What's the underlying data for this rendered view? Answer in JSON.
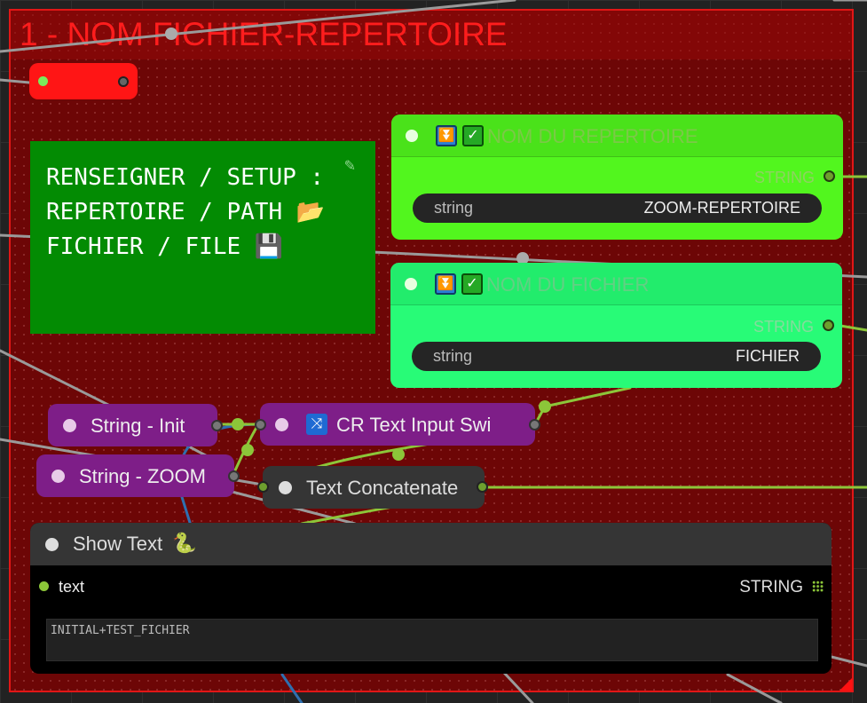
{
  "group": {
    "title": "1 - NOM FICHIER-REPERTOIRE",
    "color": "#e21616"
  },
  "note": {
    "lines": [
      "RENSEIGNER / SETUP :",
      "REPERTOIRE / PATH 📂",
      "FICHIER / FILE 💾"
    ],
    "color": "#038b03"
  },
  "repertoire_node": {
    "title": "NOM DU REPERTOIRE",
    "output_label": "STRING",
    "widget_label": "string",
    "widget_value": "ZOOM-REPERTOIRE",
    "color": "#52f61e"
  },
  "fichier_node": {
    "title": "NOM DU FICHIER",
    "output_label": "STRING",
    "widget_label": "string",
    "widget_value": "FICHIER",
    "color": "#28fb77"
  },
  "string_init": {
    "label": "String - Init",
    "color": "#7e1e88"
  },
  "string_zoom": {
    "label": "String - ZOOM",
    "color": "#7e1e88"
  },
  "cr_switch": {
    "label": "CR Text Input Swi",
    "icon": "shuffle-icon"
  },
  "concat": {
    "label": "Text Concatenate"
  },
  "show_text": {
    "title": "Show Text",
    "input_label": "text",
    "output_label": "STRING",
    "value": "INITIAL+TEST_FICHIER"
  }
}
